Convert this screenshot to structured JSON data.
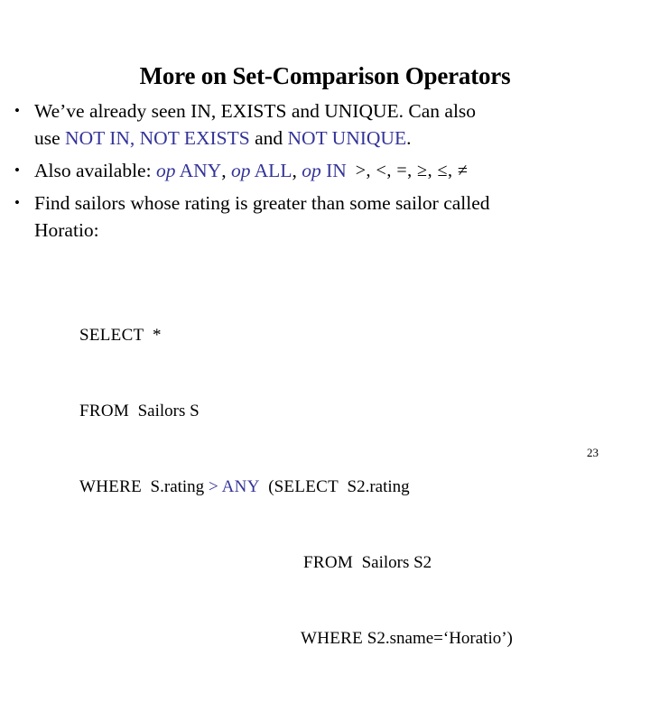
{
  "slide": {
    "title": "More on Set-Comparison Operators",
    "page_number": "23"
  },
  "bullets": [
    {
      "marker": "•",
      "line1_a": "We’ve already seen IN, EXISTS and UNIQUE.  Can also",
      "line2_a": "use ",
      "line2_kw1": "NOT IN, NOT EXISTS",
      "line2_b": " and ",
      "line2_kw2": "NOT UNIQUE",
      "line2_c": "."
    },
    {
      "marker": "•",
      "label": "Also available:  ",
      "op1_italic": "op",
      "op1_name": " ANY",
      "sep1": ",  ",
      "op2_italic": "op",
      "op2_name": " ALL",
      "sep2": ",  ",
      "op3_italic": "op",
      "op3_name": " IN",
      "operators": ">, <, =, ≥, ≤, ≠"
    },
    {
      "marker": "•",
      "line1": "Find sailors whose rating is greater than some sailor called",
      "line2": "Horatio:"
    }
  ],
  "sql": {
    "line1_kw": "SELECT",
    "line1_rest": "  *",
    "line2_kw": "FROM",
    "line2_rest": "  Sailors S",
    "line3_kw": "WHERE",
    "line3_a": "  S.rating ",
    "line3_op": ">",
    "line3_any": " ANY",
    "line3_b": "  (",
    "line3_subkw": "SELECT",
    "line3_c": "  S2.rating",
    "line4_kw": "FROM",
    "line4_rest": "  Sailors S2",
    "line5_kw": "WHERE",
    "line5_rest": " S2.sname=‘Horatio’)"
  },
  "colors": {
    "keyword_blue": "#333399",
    "text_black": "#000000",
    "background": "#ffffff"
  }
}
